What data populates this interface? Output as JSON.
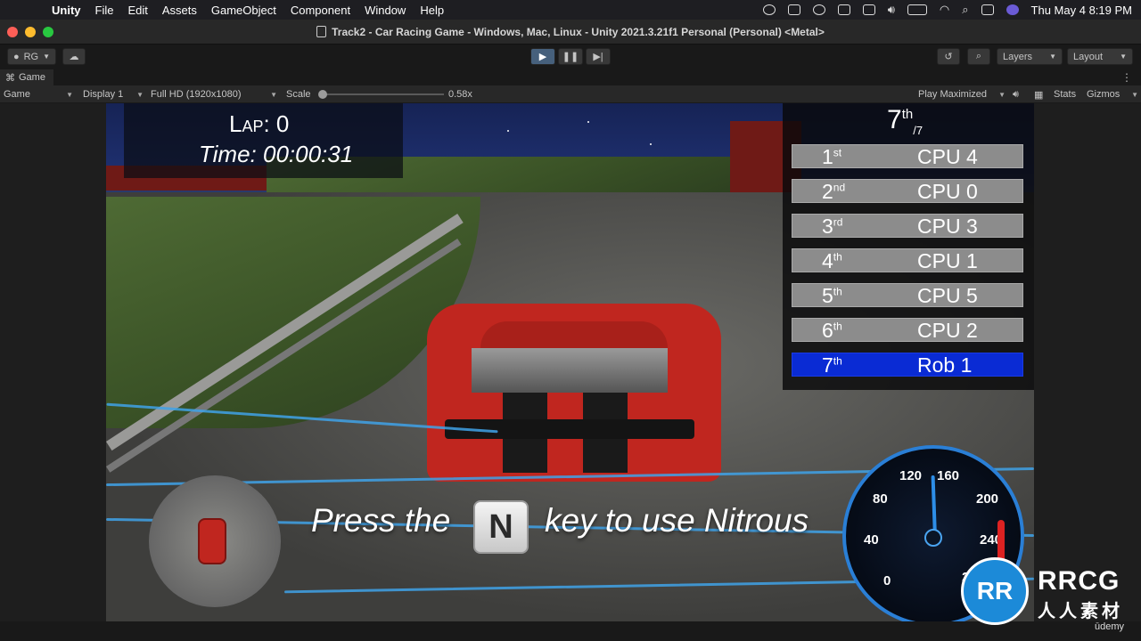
{
  "menubar": {
    "app_name": "Unity",
    "items": [
      "File",
      "Edit",
      "Assets",
      "GameObject",
      "Component",
      "Window",
      "Help"
    ],
    "datetime": "Thu May 4  8:19 PM"
  },
  "window": {
    "title": "Track2 - Car Racing Game - Windows, Mac, Linux - Unity 2021.3.21f1 Personal (Personal) <Metal>"
  },
  "toolbar": {
    "account": "RG",
    "layers": "Layers",
    "layout": "Layout"
  },
  "game_panel": {
    "tab_label": "Game",
    "view_select": "Game",
    "display": "Display 1",
    "resolution": "Full HD (1920x1080)",
    "scale_label": "Scale",
    "scale_value": "0.58x",
    "play_mode": "Play Maximized",
    "stats": "Stats",
    "gizmos": "Gizmos"
  },
  "hud": {
    "lap_label": "Lap: 0",
    "time_label": "Time: 00:00:31",
    "position": "7",
    "position_suffix": "th",
    "total": "/7",
    "standings": [
      {
        "place": "1",
        "suffix": "st",
        "name": "CPU 4",
        "player": false
      },
      {
        "place": "2",
        "suffix": "nd",
        "name": "CPU 0",
        "player": false
      },
      {
        "place": "3",
        "suffix": "rd",
        "name": "CPU 3",
        "player": false
      },
      {
        "place": "4",
        "suffix": "th",
        "name": "CPU 1",
        "player": false
      },
      {
        "place": "5",
        "suffix": "th",
        "name": "CPU 5",
        "player": false
      },
      {
        "place": "6",
        "suffix": "th",
        "name": "CPU 2",
        "player": false
      },
      {
        "place": "7",
        "suffix": "th",
        "name": "Rob 1",
        "player": true
      }
    ],
    "nitro_prefix": "Press the",
    "nitro_key": "N",
    "nitro_suffix": "key to use Nitrous",
    "speedometer_labels": [
      "0",
      "40",
      "80",
      "120",
      "160",
      "200",
      "240",
      "2"
    ],
    "speed_value": 150
  },
  "colors": {
    "player_row": "#0a2bd4",
    "cpu_row": "#8c8c8c",
    "nitro": "#3fa2e8",
    "car": "#c0261f"
  },
  "watermark": {
    "brand": "RRCG",
    "subtitle": "人人素材",
    "logo_text": "RR",
    "udemy": "ūdemy"
  }
}
